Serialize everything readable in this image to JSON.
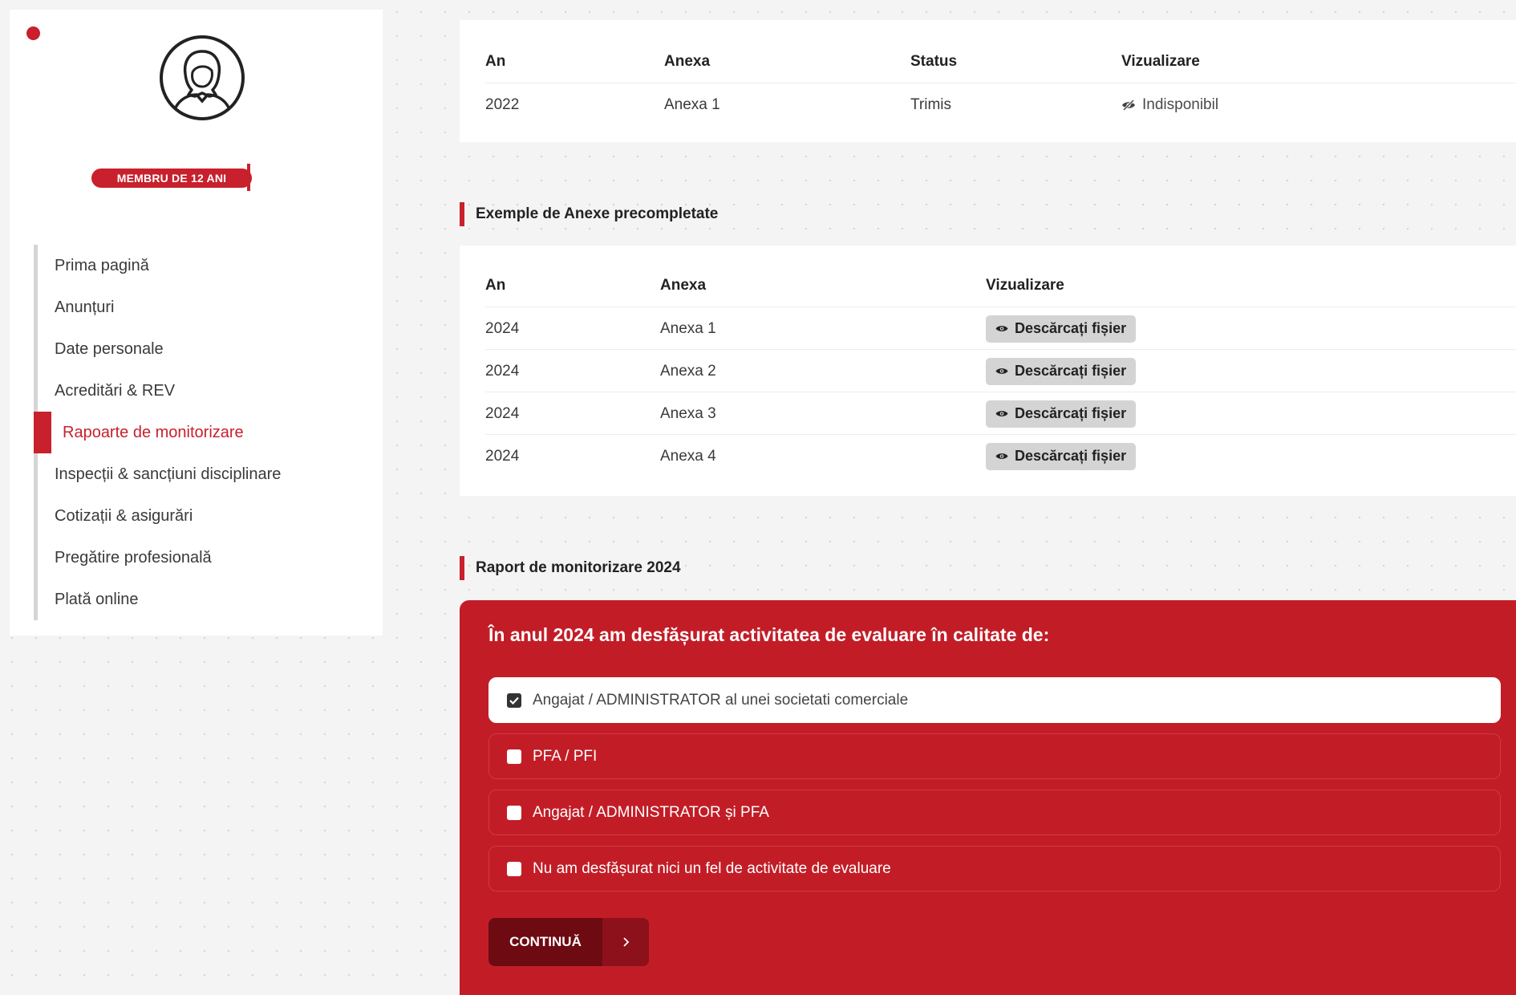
{
  "sidebar": {
    "badge": "MEMBRU DE 12 ANI",
    "nav": [
      {
        "label": "Prima pagină"
      },
      {
        "label": "Anunțuri"
      },
      {
        "label": "Date personale"
      },
      {
        "label": "Acreditări & REV"
      },
      {
        "label": "Rapoarte de monitorizare",
        "active": true
      },
      {
        "label": "Inspecții & sancțiuni disciplinare"
      },
      {
        "label": "Cotizații & asigurări"
      },
      {
        "label": "Pregătire profesională"
      },
      {
        "label": "Plată online"
      }
    ]
  },
  "reports_table": {
    "headers": {
      "year": "An",
      "annex": "Anexa",
      "status": "Status",
      "view": "Vizualizare"
    },
    "rows": [
      {
        "year": "2022",
        "annex": "Anexa 1",
        "status": "Trimis",
        "view": "Indisponibil"
      }
    ]
  },
  "examples": {
    "title": "Exemple de Anexe precompletate",
    "headers": {
      "year": "An",
      "annex": "Anexa",
      "view": "Vizualizare"
    },
    "download_label": "Descărcați fișier",
    "rows": [
      {
        "year": "2024",
        "annex": "Anexa 1"
      },
      {
        "year": "2024",
        "annex": "Anexa 2"
      },
      {
        "year": "2024",
        "annex": "Anexa 3"
      },
      {
        "year": "2024",
        "annex": "Anexa 4"
      }
    ]
  },
  "report": {
    "title": "Raport de monitorizare 2024",
    "question": "În anul 2024 am desfășurat activitatea de evaluare în calitate de:",
    "options": [
      {
        "label": "Angajat / ADMINISTRATOR al unei societati comerciale",
        "checked": true
      },
      {
        "label": "PFA / PFI",
        "checked": false
      },
      {
        "label": "Angajat / ADMINISTRATOR și PFA",
        "checked": false
      },
      {
        "label": "Nu am desfășurat nici un fel de activitate de evaluare",
        "checked": false
      }
    ],
    "continue_label": "CONTINUĂ"
  },
  "colors": {
    "accent": "#c8202c",
    "panel": "#c21d27",
    "button_dark": "#6e0a12"
  }
}
